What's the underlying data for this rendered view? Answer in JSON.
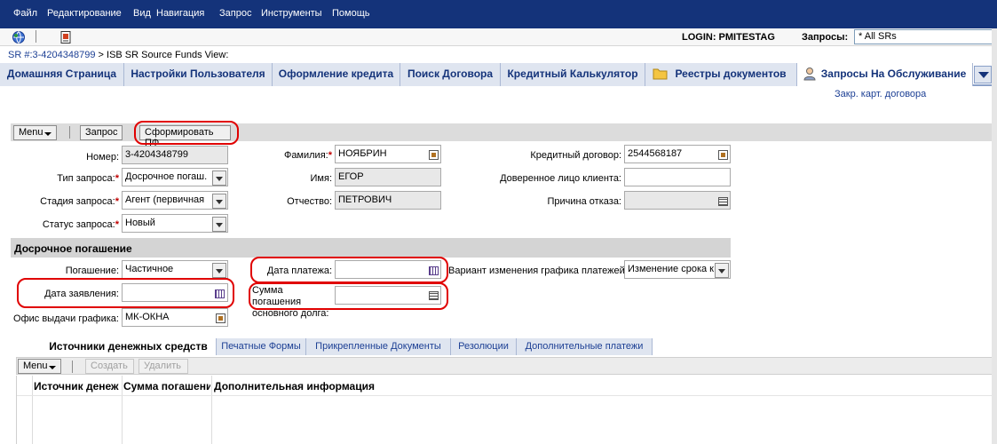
{
  "menubar": {
    "items": [
      "Файл",
      "Редактирование",
      "Вид",
      "Навигация",
      "Запрос",
      "Инструменты",
      "Помощь"
    ]
  },
  "toolbar": {
    "icons": [
      "globe-icon",
      "document-icon"
    ],
    "login": "LOGIN: PMITESTAG",
    "queries_label": "Запросы:",
    "queries_value": "* All SRs"
  },
  "breadcrumb": {
    "link": "SR #:3-4204348799",
    "rest": "> ISB SR Source Funds View:"
  },
  "tabs": [
    {
      "label": "Домашняя Страница"
    },
    {
      "label": "Настройки Пользователя"
    },
    {
      "label": "Оформление кредита"
    },
    {
      "label": "Поиск Договора"
    },
    {
      "label": "Кредитный Калькулятор"
    },
    {
      "label": "Реестры документов",
      "icon": "folder-icon"
    },
    {
      "label": "Запросы На Обслуживание",
      "icon": "user-icon",
      "active": true
    }
  ],
  "subtab": "Закр. карт. договора",
  "actions": {
    "menu": "Menu",
    "query": "Запрос",
    "generate": "Сформировать ПФ"
  },
  "form": {
    "number_label": "Номер:",
    "number_value": "3-4204348799",
    "type_label": "Тип запроса:",
    "type_value": "Досрочное погаш.",
    "stage_label": "Стадия запроса:",
    "stage_value": "Агент (первичная",
    "status_label": "Статус запроса:",
    "status_value": "Новый",
    "lastname_label": "Фамилия:",
    "lastname_value": "НОЯБРИН",
    "firstname_label": "Имя:",
    "firstname_value": "ЕГОР",
    "patronymic_label": "Отчество:",
    "patronymic_value": "ПЕТРОВИЧ",
    "contract_label": "Кредитный договор:",
    "contract_value": "2544568187",
    "trusted_label": "Доверенное лицо клиента:",
    "trusted_value": "",
    "reason_label": "Причина отказа:",
    "reason_value": ""
  },
  "early": {
    "section_title": "Досрочное погашение",
    "repayment_label": "Погашение:",
    "repayment_value": "Частичное",
    "app_date_label": "Дата заявления:",
    "app_date_value": "",
    "office_label": "Офис выдачи графика:",
    "office_value": "МК-ОКНА",
    "pay_date_label": "Дата платежа:",
    "pay_date_value": "",
    "principal_label_1": "Сумма погашения",
    "principal_label_2": "основного долга:",
    "principal_value": "",
    "schedule_label": "Вариант изменения графика платежей:",
    "schedule_value": "Изменение срока к"
  },
  "bottom_tabs": [
    {
      "label": "Источники денежных средств",
      "active": true
    },
    {
      "label": "Печатные Формы"
    },
    {
      "label": "Прикрепленные Документы"
    },
    {
      "label": "Резолюции"
    },
    {
      "label": "Дополнительные платежи"
    }
  ],
  "list": {
    "menu": "Menu",
    "create": "Создать",
    "delete": "Удалить",
    "columns": [
      "Источник денеж",
      "Сумма погашени",
      "Дополнительная информация"
    ]
  }
}
